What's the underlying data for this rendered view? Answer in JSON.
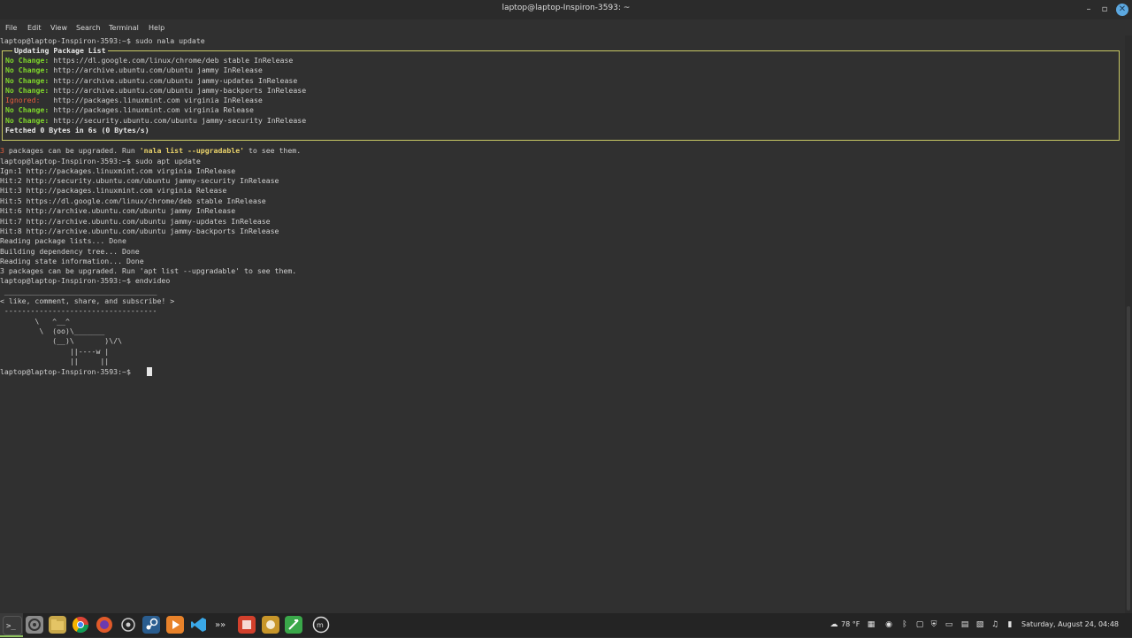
{
  "window": {
    "title": "laptop@laptop-Inspiron-3593: ~",
    "minimize_glyph": "–",
    "maximize_glyph": "▫",
    "close_glyph": "✕"
  },
  "menu": [
    "File",
    "Edit",
    "View",
    "Search",
    "Terminal",
    "Help"
  ],
  "prompt": "laptop@laptop-Inspiron-3593:~$",
  "terminal": {
    "cmd1": " sudo nala update",
    "nala_title": "Updating Package List",
    "nala_lines": [
      {
        "status": "No Change:",
        "text": " https://dl.google.com/linux/chrome/deb stable InRelease"
      },
      {
        "status": "No Change:",
        "text": " http://archive.ubuntu.com/ubuntu jammy InRelease"
      },
      {
        "status": "No Change:",
        "text": " http://archive.ubuntu.com/ubuntu jammy-updates InRelease"
      },
      {
        "status": "No Change:",
        "text": " http://archive.ubuntu.com/ubuntu jammy-backports InRelease"
      },
      {
        "status": "Ignored:",
        "text": "   http://packages.linuxmint.com virginia InRelease"
      },
      {
        "status": "No Change:",
        "text": " http://packages.linuxmint.com virginia Release"
      },
      {
        "status": "No Change:",
        "text": " http://security.ubuntu.com/ubuntu jammy-security InRelease"
      }
    ],
    "fetched": "Fetched 0 Bytes in 6s (0 Bytes/s)",
    "upgrade_count": "3",
    "upgrade_mid": " packages can be upgraded. Run ",
    "upgrade_cmd": "'nala list --upgradable'",
    "upgrade_end": " to see them.",
    "cmd2": " sudo apt update",
    "apt_lines": [
      "Ign:1 http://packages.linuxmint.com virginia InRelease",
      "Hit:2 http://security.ubuntu.com/ubuntu jammy-security InRelease",
      "Hit:3 http://packages.linuxmint.com virginia Release",
      "Hit:5 https://dl.google.com/linux/chrome/deb stable InRelease",
      "Hit:6 http://archive.ubuntu.com/ubuntu jammy InRelease",
      "Hit:7 http://archive.ubuntu.com/ubuntu jammy-updates InRelease",
      "Hit:8 http://archive.ubuntu.com/ubuntu jammy-backports InRelease",
      "Reading package lists... Done",
      "Building dependency tree... Done",
      "Reading state information... Done",
      "3 packages can be upgraded. Run 'apt list --upgradable' to see them."
    ],
    "cmd3": " endvideo",
    "cowsay": [
      " ___________________________________",
      "< like, comment, share, and subscribe! >",
      " -----------------------------------",
      "        \\   ^__^",
      "         \\  (oo)\\_______",
      "            (__)\\       )\\/\\",
      "                ||----w |",
      "                ||     ||"
    ]
  },
  "taskbar": {
    "apps": [
      {
        "name": "terminal",
        "color": "#3a3a3a"
      },
      {
        "name": "settings",
        "color": "#8a8a8a"
      },
      {
        "name": "files",
        "color": "#c8a84a"
      },
      {
        "name": "chrome",
        "color": "#3d8fd8"
      },
      {
        "name": "firefox",
        "color": "#e05a2a"
      },
      {
        "name": "system",
        "color": "#7a7a7a"
      },
      {
        "name": "steam",
        "color": "#2a5d8f"
      },
      {
        "name": "media-player",
        "color": "#e8822a"
      },
      {
        "name": "vscode",
        "color": "#3aa8e8"
      },
      {
        "name": "code-arrows",
        "color": "#9a9a9a"
      },
      {
        "name": "app-red",
        "color": "#d2402c"
      },
      {
        "name": "app-gold",
        "color": "#c8962a"
      },
      {
        "name": "app-green",
        "color": "#3aa84a"
      },
      {
        "name": "mint-menu",
        "color": "#6a6a6a"
      }
    ],
    "weather": "78 °F",
    "clock": "Saturday, August 24, 04:48"
  }
}
